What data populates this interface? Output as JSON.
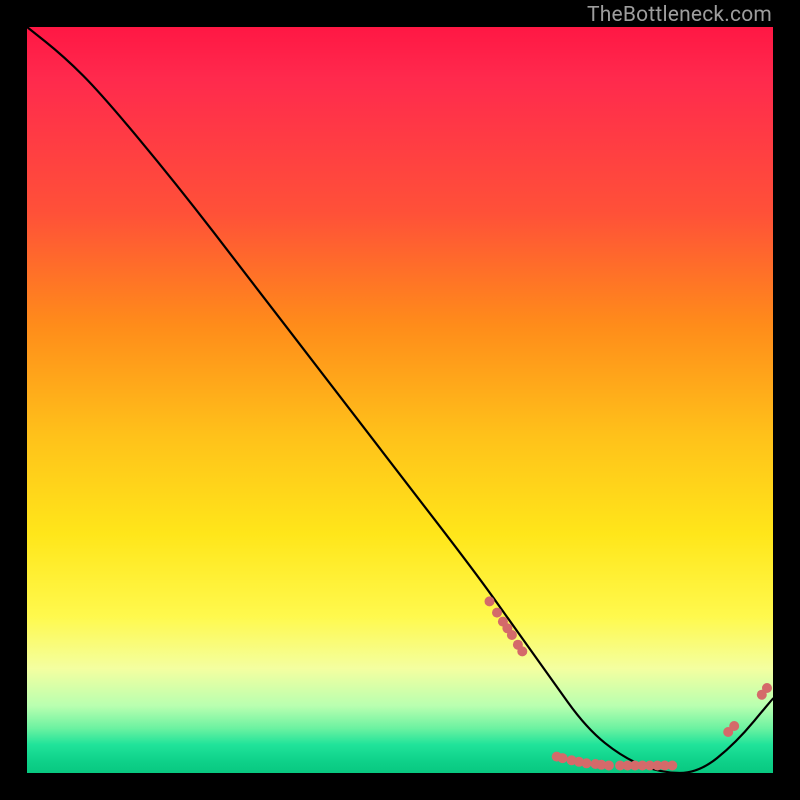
{
  "watermark": "TheBottleneck.com",
  "chart_data": {
    "type": "line",
    "title": "",
    "xlabel": "",
    "ylabel": "",
    "xlim": [
      0,
      100
    ],
    "ylim": [
      0,
      100
    ],
    "series": [
      {
        "name": "curve",
        "x": [
          0,
          5,
          10,
          20,
          30,
          40,
          50,
          60,
          65,
          70,
          75,
          80,
          85,
          90,
          95,
          100
        ],
        "y": [
          100,
          96,
          91,
          79,
          66,
          53,
          40,
          27,
          20,
          13,
          6,
          2,
          0,
          0,
          4,
          10
        ]
      }
    ],
    "markers": [
      {
        "x": 62.0,
        "y": 23.0
      },
      {
        "x": 63.0,
        "y": 21.5
      },
      {
        "x": 63.8,
        "y": 20.3
      },
      {
        "x": 64.4,
        "y": 19.4
      },
      {
        "x": 65.0,
        "y": 18.5
      },
      {
        "x": 65.8,
        "y": 17.2
      },
      {
        "x": 66.4,
        "y": 16.3
      },
      {
        "x": 71.0,
        "y": 2.2
      },
      {
        "x": 71.8,
        "y": 2.0
      },
      {
        "x": 73.0,
        "y": 1.7
      },
      {
        "x": 74.0,
        "y": 1.5
      },
      {
        "x": 75.0,
        "y": 1.3
      },
      {
        "x": 76.2,
        "y": 1.2
      },
      {
        "x": 77.0,
        "y": 1.1
      },
      {
        "x": 78.0,
        "y": 1.0
      },
      {
        "x": 79.5,
        "y": 1.0
      },
      {
        "x": 80.5,
        "y": 1.0
      },
      {
        "x": 81.5,
        "y": 1.0
      },
      {
        "x": 82.5,
        "y": 1.0
      },
      {
        "x": 83.5,
        "y": 1.0
      },
      {
        "x": 84.5,
        "y": 1.0
      },
      {
        "x": 85.5,
        "y": 1.0
      },
      {
        "x": 86.5,
        "y": 1.0
      },
      {
        "x": 94.0,
        "y": 5.5
      },
      {
        "x": 94.8,
        "y": 6.3
      },
      {
        "x": 98.5,
        "y": 10.5
      },
      {
        "x": 99.2,
        "y": 11.4
      }
    ],
    "line_color": "#000000",
    "marker_color": "#d46a6a",
    "marker_radius_px": 5
  }
}
